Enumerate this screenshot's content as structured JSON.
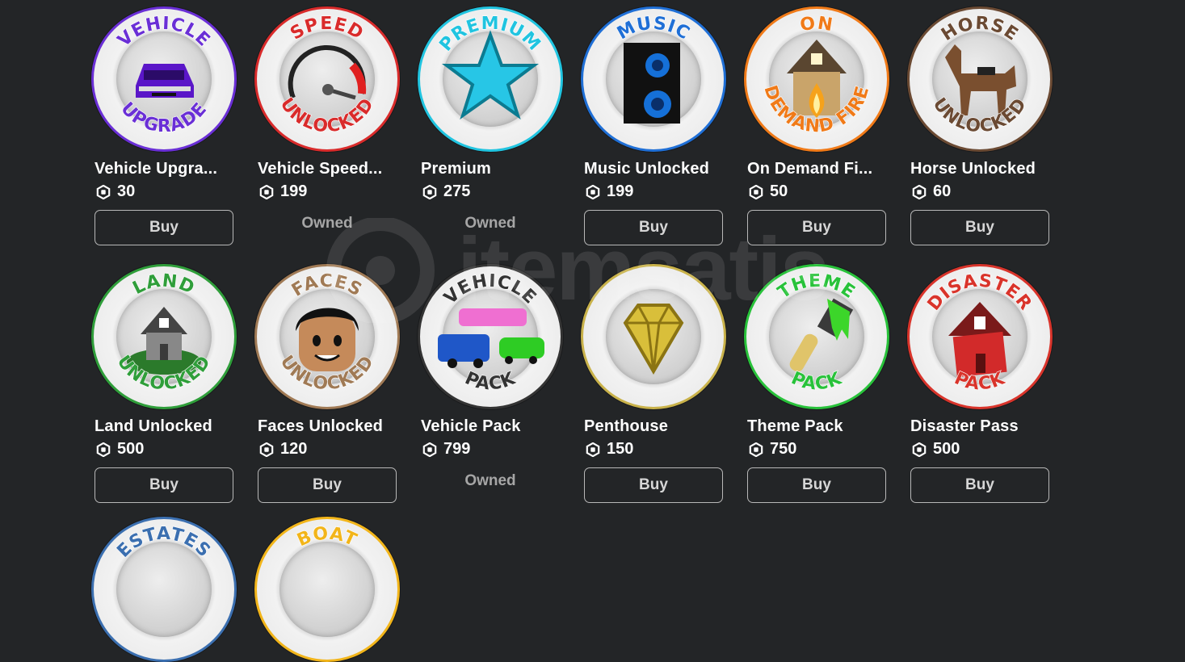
{
  "watermark": "itemsatis",
  "currency_icon": "robux-icon",
  "items": [
    {
      "name": "Vehicle Upgra...",
      "price": "30",
      "status": "buy",
      "button": "Buy",
      "ring_top": "VEHICLE",
      "ring_bottom": "UPGRADE",
      "color": "#6a2fd6",
      "art": "car-icon"
    },
    {
      "name": "Vehicle Speed...",
      "price": "199",
      "status": "owned",
      "owned_label": "Owned",
      "ring_top": "SPEED",
      "ring_bottom": "UNLOCKED",
      "color": "#d92b2b",
      "art": "speedometer-icon"
    },
    {
      "name": "Premium",
      "price": "275",
      "status": "owned",
      "owned_label": "Owned",
      "ring_top": "PREMIUM",
      "ring_bottom": "",
      "color": "#20c4e0",
      "art": "star-icon"
    },
    {
      "name": "Music Unlocked",
      "price": "199",
      "status": "buy",
      "button": "Buy",
      "ring_top": "MUSIC",
      "ring_bottom": "",
      "color": "#1f6fd6",
      "art": "speaker-icon"
    },
    {
      "name": "On Demand Fi...",
      "price": "50",
      "status": "buy",
      "button": "Buy",
      "ring_top": "ON",
      "ring_bottom": "DEMAND FIRE",
      "color": "#f07a18",
      "art": "burning-house-icon"
    },
    {
      "name": "Horse Unlocked",
      "price": "60",
      "status": "buy",
      "button": "Buy",
      "ring_top": "HORSE",
      "ring_bottom": "UNLOCKED",
      "color": "#6b4a33",
      "art": "horse-icon"
    },
    {
      "name": "Land Unlocked",
      "price": "500",
      "status": "buy",
      "button": "Buy",
      "ring_top": "LAND",
      "ring_bottom": "UNLOCKED",
      "color": "#2f9e3a",
      "art": "land-house-icon"
    },
    {
      "name": "Faces Unlocked",
      "price": "120",
      "status": "buy",
      "button": "Buy",
      "ring_top": "FACES",
      "ring_bottom": "UNLOCKED",
      "color": "#a07a55",
      "art": "face-icon"
    },
    {
      "name": "Vehicle Pack",
      "price": "799",
      "status": "owned",
      "owned_label": "Owned",
      "ring_top": "VEHICLE",
      "ring_bottom": "PACK",
      "color": "#333333",
      "art": "vehicles-icon"
    },
    {
      "name": "Penthouse",
      "price": "150",
      "status": "buy",
      "button": "Buy",
      "ring_top": "",
      "ring_bottom": "",
      "color": "#c9b24a",
      "art": "diamond-icon"
    },
    {
      "name": "Theme Pack",
      "price": "750",
      "status": "buy",
      "button": "Buy",
      "ring_top": "THEME",
      "ring_bottom": "PACK",
      "color": "#28c23a",
      "art": "paintbrush-icon"
    },
    {
      "name": "Disaster Pass",
      "price": "500",
      "status": "buy",
      "button": "Buy",
      "ring_top": "DISASTER",
      "ring_bottom": "PACK",
      "color": "#d9342b",
      "art": "disaster-house-icon"
    }
  ],
  "partial_items": [
    {
      "ring_top": "ESTATES",
      "color": "#3b6fb0"
    },
    {
      "ring_top": "BOAT",
      "color": "#f2b51a"
    }
  ]
}
